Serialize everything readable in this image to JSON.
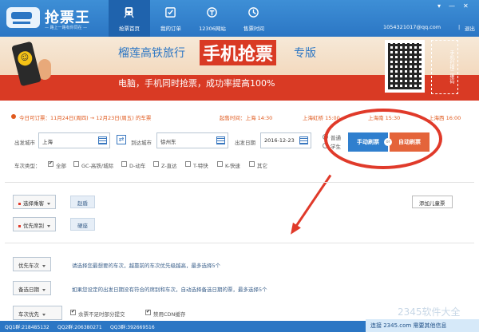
{
  "app": {
    "title": "抢票王",
    "subtitle": "— 路上一路有你同在 —"
  },
  "nav": {
    "items": [
      {
        "label": "抢票首页"
      },
      {
        "label": "我的订单"
      },
      {
        "label": "12306网站"
      },
      {
        "label": "售票时间"
      }
    ]
  },
  "account": {
    "email": "1054321017@qq.com",
    "separator": "|",
    "logout": "退出"
  },
  "banner": {
    "line1_prefix": "榴莲高铁旅行",
    "line1_big": "手机抢票",
    "line1_suffix": "专版",
    "line2": "电脑，手机同时抢票，成功率提高100%",
    "qr_note": "手机扫描二维码"
  },
  "sale": {
    "notice": "今日可订票：11月24日(周四) → 12月23日(周五) 的车票",
    "times": [
      "起售时间：上海 14:30",
      "上海虹桥 15:00",
      "上海南 15:30",
      "上海西 16:00"
    ]
  },
  "form": {
    "from_label": "出发城市",
    "from_value": "上海",
    "to_label": "到达城市",
    "to_value": "徐州东",
    "date_label": "出发日期",
    "date_value": "2016-12-23",
    "radio_normal": "普通",
    "radio_student": "学生",
    "btn_manual": "手动刷票",
    "btn_auto": "自动刷票",
    "or": "or"
  },
  "train_types": {
    "label": "车次类型：",
    "options": [
      "全部",
      "GC-高铁/城际",
      "D-动车",
      "Z-直达",
      "T-特快",
      "K-快速",
      "其它"
    ]
  },
  "passenger": {
    "select_label": "选择乘客",
    "chip": "赵盾",
    "add_child": "添加儿童票"
  },
  "seat": {
    "select_label": "优先席别",
    "chip": "硬座"
  },
  "priority_train": {
    "label": "优先车次",
    "hint": "请选择您最想要的车次，越靠前的车次优先级越高，最多选择5个"
  },
  "backup_date": {
    "label": "备选日期",
    "hint": "如果您设定的出发日期没有符合的席别和车次，自动选择备选日期的票，最多选择5个"
  },
  "bottom_opts": {
    "sort_label": "车次优先",
    "cb1": "余票不足时部分提交",
    "cb2": "禁用CDN缓存"
  },
  "status": {
    "qq1": "QQ1群:218485132",
    "qq2": "QQ2群:206380271",
    "qq3": "QQ3群:392669516",
    "connect": "连接 2345.com 需要其他信息",
    "watermark": "2345软件大全"
  }
}
